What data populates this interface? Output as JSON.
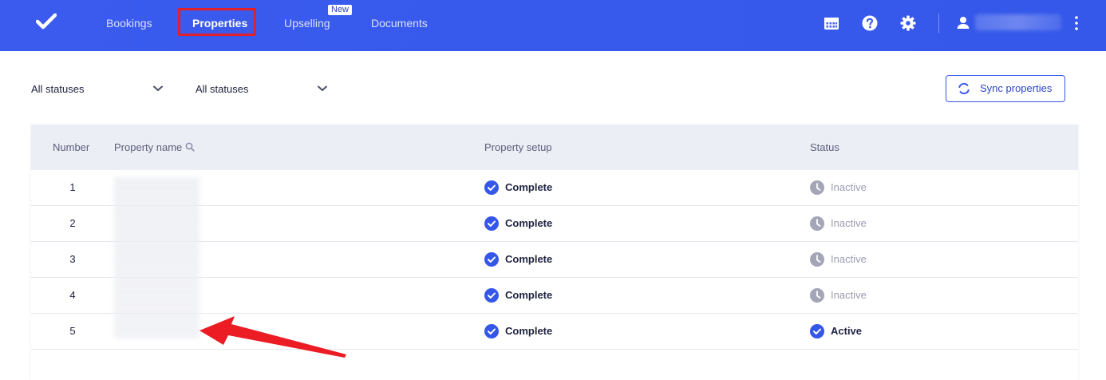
{
  "nav": {
    "items": [
      {
        "label": "Bookings"
      },
      {
        "label": "Properties"
      },
      {
        "label": "Upselling",
        "badge": "New"
      },
      {
        "label": "Documents"
      }
    ]
  },
  "filters": [
    {
      "label": "All statuses"
    },
    {
      "label": "All statuses"
    }
  ],
  "sync_button": {
    "label": "Sync properties"
  },
  "table": {
    "headers": {
      "number": "Number",
      "property_name": "Property name",
      "property_setup": "Property setup",
      "status": "Status"
    },
    "rows": [
      {
        "number": "1",
        "setup": "Complete",
        "status": "Inactive"
      },
      {
        "number": "2",
        "setup": "Complete",
        "status": "Inactive"
      },
      {
        "number": "3",
        "setup": "Complete",
        "status": "Inactive"
      },
      {
        "number": "4",
        "setup": "Complete",
        "status": "Inactive"
      },
      {
        "number": "5",
        "setup": "Complete",
        "status": "Active"
      }
    ]
  },
  "colors": {
    "brand": "#3a5bee",
    "highlight": "#e3202a",
    "check": "#3557e8",
    "inactive": "#9b9db0"
  },
  "icons": [
    "check-logo-icon",
    "calendar-grid-icon",
    "help-icon",
    "gear-icon",
    "user-icon",
    "more-vertical-icon",
    "chevron-down-icon",
    "sync-icon",
    "search-icon",
    "check-circle-icon",
    "clock-icon"
  ]
}
